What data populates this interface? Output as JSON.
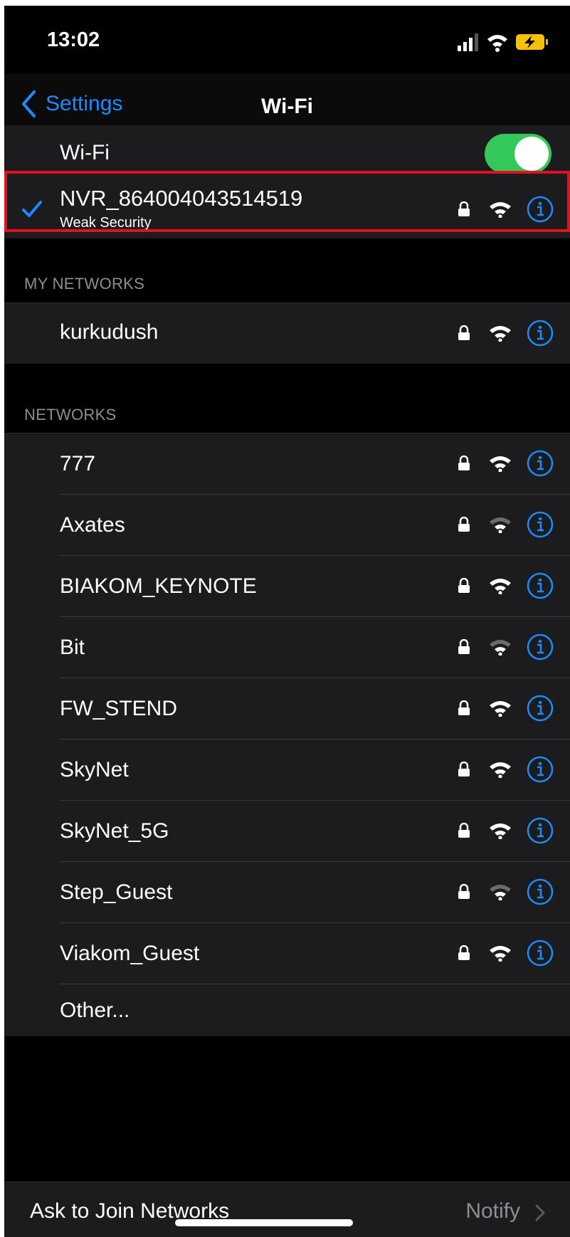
{
  "status": {
    "time": "13:02"
  },
  "nav": {
    "back_label": "Settings",
    "title": "Wi-Fi"
  },
  "wifi": {
    "label": "Wi-Fi",
    "enabled": true
  },
  "connected": {
    "name": "NVR_864004043514519",
    "subtitle": "Weak Security"
  },
  "my_networks": {
    "header": "MY NETWORKS",
    "items": [
      {
        "name": "kurkudush",
        "signal": "strong"
      }
    ]
  },
  "networks": {
    "header": "NETWORKS",
    "items": [
      {
        "name": "777",
        "signal": "strong"
      },
      {
        "name": "Axates",
        "signal": "weak"
      },
      {
        "name": "BIAKOM_KEYNOTE",
        "signal": "strong"
      },
      {
        "name": "Bit",
        "signal": "weak"
      },
      {
        "name": "FW_STEND",
        "signal": "strong"
      },
      {
        "name": "SkyNet",
        "signal": "strong"
      },
      {
        "name": "SkyNet_5G",
        "signal": "strong"
      },
      {
        "name": "Step_Guest",
        "signal": "weak"
      },
      {
        "name": "Viakom_Guest",
        "signal": "strong"
      }
    ],
    "other_label": "Other..."
  },
  "ask_to_join": {
    "label": "Ask to Join Networks",
    "value": "Notify"
  },
  "colors": {
    "accent": "#1a8cff",
    "toggle_on": "#34c759",
    "highlight": "#e3101e"
  }
}
